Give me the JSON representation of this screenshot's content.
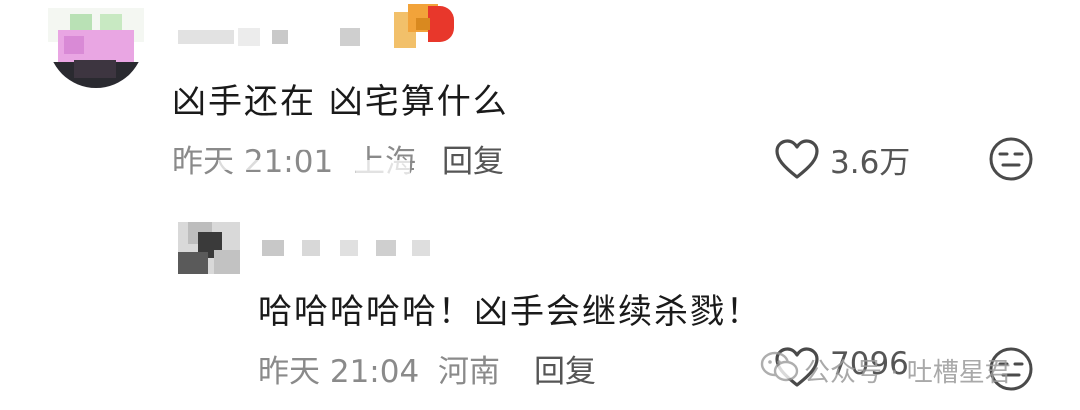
{
  "comment": {
    "text": "凶手还在 凶宅算什么",
    "time": "昨天 21:01",
    "location": "上海",
    "reply_label": "回复",
    "like_count": "3.6万"
  },
  "reply": {
    "text": "哈哈哈哈哈！凶手会继续杀戮！",
    "time": "昨天 21:04",
    "location": "河南",
    "reply_label": "回复",
    "like_count": "7096"
  },
  "watermark": {
    "text": "公众号 · 吐槽星君"
  },
  "colors": {
    "meta_gray": "#8a8a8a",
    "text_dark": "#1a1a1a",
    "badge_orange": "#f2a33a",
    "badge_red": "#e8372b"
  }
}
